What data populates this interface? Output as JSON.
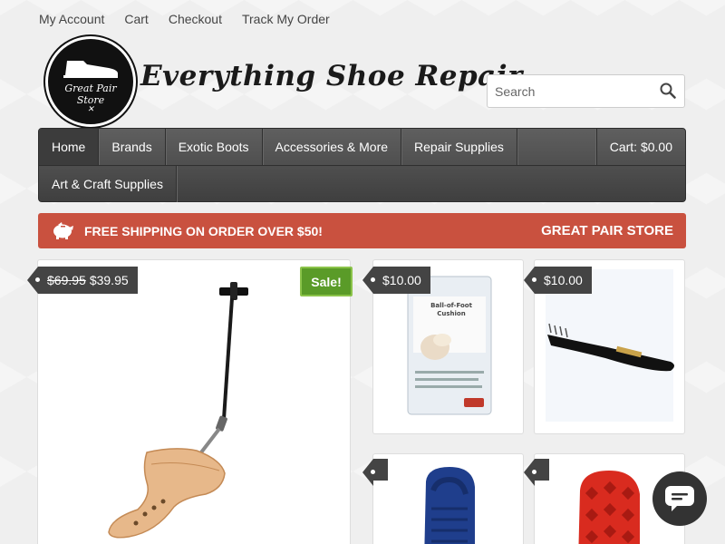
{
  "top_nav": {
    "my_account": "My Account",
    "cart": "Cart",
    "checkout": "Checkout",
    "track_order": "Track My Order"
  },
  "logo": {
    "line1": "Great Pair",
    "line2": "Store",
    "mark": "✕"
  },
  "brand_title": "Everything Shoe Repair",
  "search": {
    "placeholder": "Search",
    "icon": "search-icon"
  },
  "main_nav": {
    "items": [
      "Home",
      "Brands",
      "Exotic Boots",
      "Accessories & More",
      "Repair Supplies"
    ],
    "row2_items": [
      "Art & Craft Supplies"
    ],
    "cart": "Cart: $0.00",
    "active": "Home"
  },
  "banner": {
    "icon": "piggy-bank-icon",
    "shipping": "FREE SHIPPING ON ORDER OVER $50!",
    "store": "GREAT PAIR STORE",
    "color": "#c9513f"
  },
  "products": [
    {
      "old_price": "$69.95",
      "price": "$39.95",
      "badge": "Sale!",
      "image": "shoe-tree-stretcher"
    },
    {
      "price": "$10.00",
      "image": "ball-of-foot-cushion-package"
    },
    {
      "price": "$10.00",
      "image": "suede-brush"
    },
    {
      "price": "",
      "image": "blue-rubber-sole"
    },
    {
      "price": "",
      "image": "red-rubber-heel-sole"
    }
  ],
  "colors": {
    "nav": "#4a4a4a",
    "sale": "#5a9b28",
    "price_tag": "#444444"
  },
  "chat": {
    "icon": "chat-bubble-icon"
  }
}
